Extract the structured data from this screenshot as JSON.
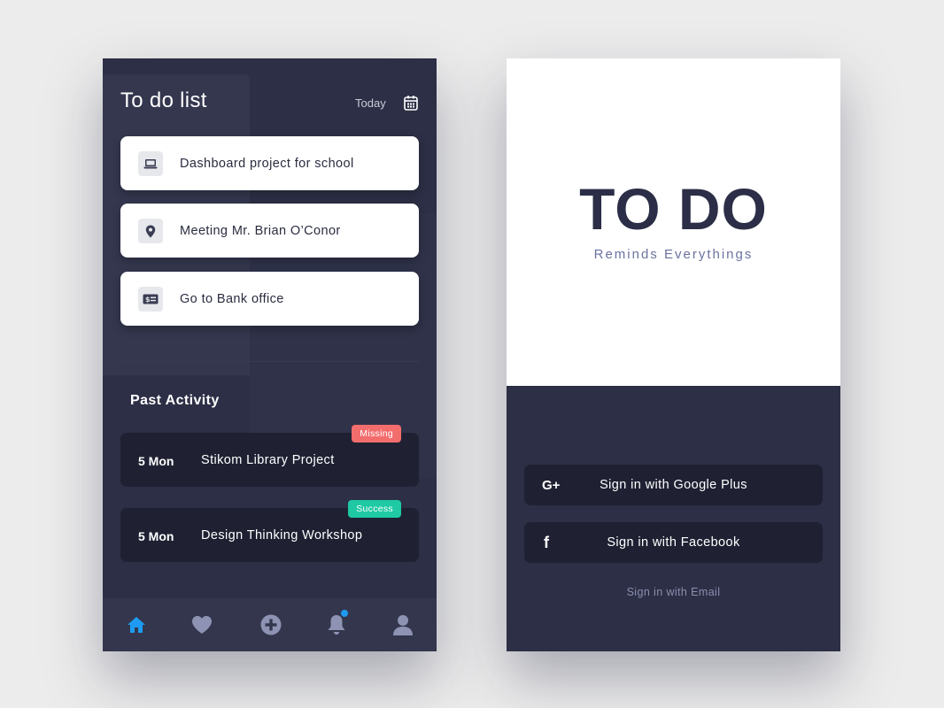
{
  "todo_screen": {
    "title": "To do list",
    "date_filter": "Today",
    "tasks": [
      {
        "label": "Dashboard project for school",
        "icon": "laptop-icon"
      },
      {
        "label": "Meeting Mr. Brian O’Conor",
        "icon": "location-pin-icon"
      },
      {
        "label": "Go to Bank office",
        "icon": "money-card-icon"
      }
    ],
    "past_activity": {
      "title": "Past Activity",
      "items": [
        {
          "date": "5 Mon",
          "label": "Stikom Library Project",
          "status": "Missing",
          "status_color": "#f36d6d"
        },
        {
          "date": "5 Mon",
          "label": "Design Thinking Workshop",
          "status": "Success",
          "status_color": "#1ec9a4"
        }
      ]
    },
    "nav": [
      {
        "icon": "home-icon",
        "active": true
      },
      {
        "icon": "heart-icon",
        "active": false
      },
      {
        "icon": "plus-circle-icon",
        "active": false
      },
      {
        "icon": "bell-icon",
        "active": false,
        "has_notification": true
      },
      {
        "icon": "user-icon",
        "active": false
      }
    ]
  },
  "login_screen": {
    "app_name": "TO DO",
    "tagline": "Reminds Everythings",
    "buttons": {
      "google": "Sign in with Google Plus",
      "google_icon_text": "G+",
      "facebook": "Sign in with Facebook",
      "facebook_icon_text": "f"
    },
    "email_link": "Sign in with Email"
  },
  "colors": {
    "background": "#ececec",
    "dark_panel": "#2c2f45",
    "card_dark": "#1f2133",
    "accent_blue": "#1e9bf0",
    "missing": "#f36d6d",
    "success": "#1ec9a4",
    "title_navy": "#2b2e46"
  }
}
